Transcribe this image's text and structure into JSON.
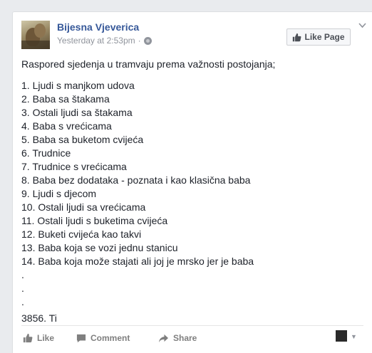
{
  "post": {
    "page_name": "Bijesna Vjeverica",
    "timestamp": "Yesterday at 2:53pm",
    "separator": "·",
    "like_page_label": "Like Page",
    "intro": "Raspored sjedenja u tramvaju prema važnosti postojanja;",
    "list": [
      "1. Ljudi s manjkom udova",
      "2. Baba sa štakama",
      "3. Ostali ljudi sa štakama",
      "4. Baba s vrećicama",
      "5. Baba sa buketom cvijeća",
      "6. Trudnice",
      "7. Trudnice s vrećicama",
      "8. Baba bez dodataka - poznata i kao klasična baba",
      "9. Ljudi s djecom",
      "10. Ostali ljudi sa vrećicama",
      "11. Ostali ljudi s buketima cvijeća",
      "12. Buketi cvijeća kao takvi",
      "13. Baba koja se vozi jednu stanicu",
      "14. Baba koja može stajati ali joj je mrsko jer je baba"
    ],
    "dots": [
      ".",
      ".",
      "."
    ],
    "outro": "3856. Ti"
  },
  "actions": {
    "like": "Like",
    "comment": "Comment",
    "share": "Share"
  },
  "icons": {
    "menu": "chevron-down-icon",
    "privacy": "globe-icon",
    "like": "thumbs-up-icon",
    "comment": "comment-icon",
    "share": "share-arrow-icon"
  },
  "colors": {
    "link": "#365899",
    "text": "#1d2129",
    "meta": "#90949c",
    "background": "#e9ebee"
  }
}
